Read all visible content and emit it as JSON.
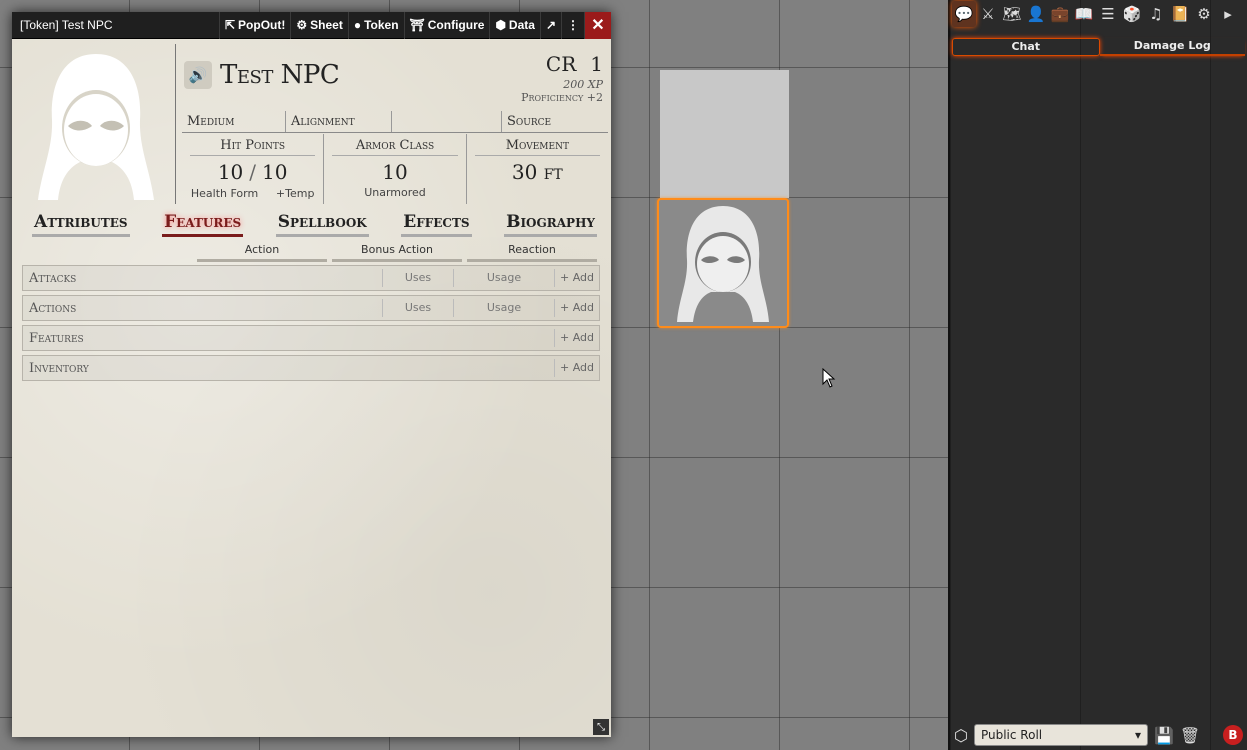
{
  "sheet": {
    "title": "[Token] Test NPC",
    "header_buttons": {
      "popout": "PopOut!",
      "sheet": "Sheet",
      "token": "Token",
      "configure": "Configure",
      "data": "Data"
    },
    "name": "Test NPC",
    "cr_label": "CR",
    "cr_value": "1",
    "xp": "200 XP",
    "proficiency": "Proficiency +2",
    "traits": {
      "size": "Medium",
      "alignment": "Alignment",
      "empty": "",
      "source": "Source"
    },
    "hit_points": {
      "label": "Hit Points",
      "current": "10",
      "separator": "/",
      "max": "10",
      "sub_left": "Health Form",
      "sub_right": "+Temp"
    },
    "armor_class": {
      "label": "Armor Class",
      "value": "10",
      "sub": "Unarmored"
    },
    "movement": {
      "label": "Movement",
      "value": "30 ft"
    },
    "tabs": [
      "Attributes",
      "Features",
      "Spellbook",
      "Effects",
      "Biography"
    ],
    "active_tab": "Features",
    "subheads": [
      "Action",
      "Bonus Action",
      "Reaction"
    ],
    "sections": [
      {
        "name": "Attacks",
        "uses": "Uses",
        "usage": "Usage",
        "add": "+ Add"
      },
      {
        "name": "Actions",
        "uses": "Uses",
        "usage": "Usage",
        "add": "+ Add"
      },
      {
        "name": "Features",
        "add": "+ Add"
      },
      {
        "name": "Inventory",
        "add": "+ Add"
      }
    ]
  },
  "sidebar": {
    "chat_tabs": [
      "Chat",
      "Damage Log"
    ],
    "roll_mode": "Public Roll",
    "icons": [
      "chat-icon",
      "combat-icon",
      "scenes-icon",
      "actors-icon",
      "items-icon",
      "journal-icon",
      "tables-icon",
      "cards-icon",
      "playlists-icon",
      "compendium-icon",
      "settings-icon",
      "collapse-icon"
    ]
  },
  "colors": {
    "accent": "#ff5a00",
    "close": "#9b1b1b",
    "token_border": "#ff8c1a",
    "active_tab": "#7a1c1c"
  }
}
